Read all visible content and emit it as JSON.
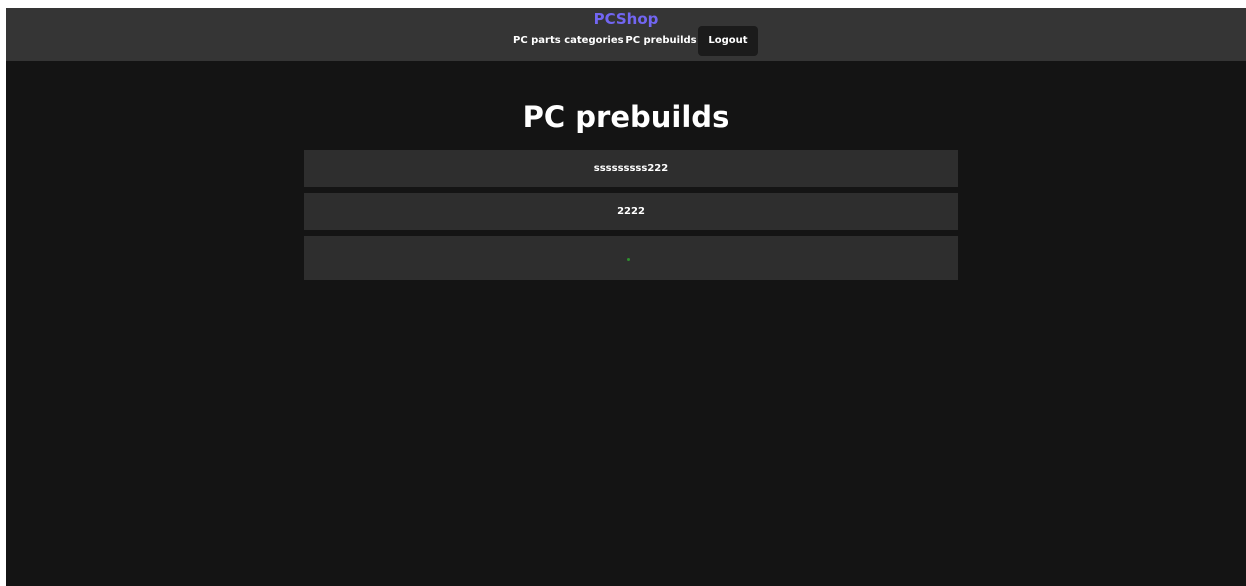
{
  "header": {
    "brand": "PCShop",
    "nav": {
      "categories_label": "PC parts categories",
      "prebuilds_label": "PC prebuilds",
      "logout_label": "Logout"
    }
  },
  "main": {
    "title": "PC prebuilds",
    "prebuilds": [
      {
        "name": "sssssssss222"
      },
      {
        "name": "2222"
      },
      {
        "name": ""
      }
    ]
  },
  "colors": {
    "brand": "#7266f2",
    "page_background": "#141414",
    "navbar_background": "#353535",
    "card_background": "#2e2e2e",
    "dot": "#2f8f2f"
  }
}
